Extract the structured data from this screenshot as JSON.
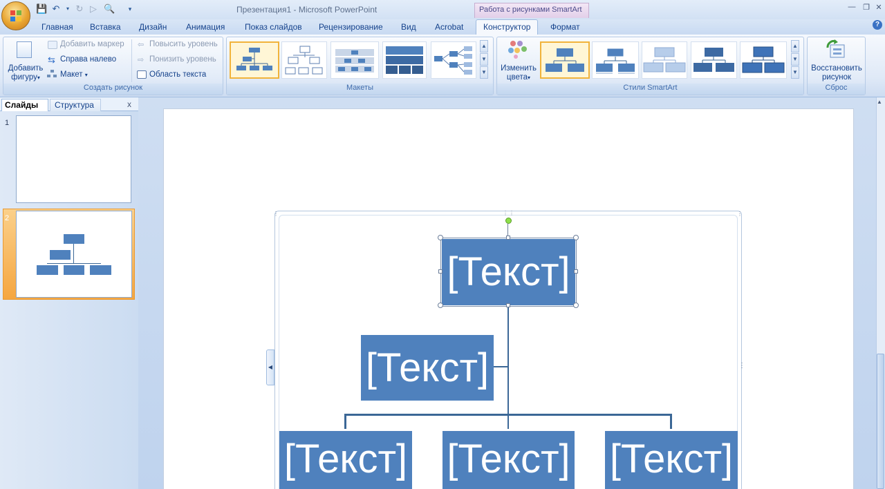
{
  "title_bar": {
    "document_title": "Презентация1 - Microsoft PowerPoint",
    "context_tab_header": "Работа с рисунками SmartArt"
  },
  "tabs": [
    "Главная",
    "Вставка",
    "Дизайн",
    "Анимация",
    "Показ слайдов",
    "Рецензирование",
    "Вид",
    "Acrobat",
    "Конструктор",
    "Формат"
  ],
  "active_tab": "Конструктор",
  "ribbon": {
    "create_graphic": {
      "label": "Создать рисунок",
      "add_shape": "Добавить фигуру",
      "add_shape_line1": "Добавить",
      "add_shape_line2": "фигуру",
      "add_bullet": "Добавить маркер",
      "right_to_left": "Справа налево",
      "layout": "Макет",
      "promote": "Повысить уровень",
      "demote": "Понизить уровень",
      "text_pane": "Область текста"
    },
    "layouts": {
      "label": "Макеты"
    },
    "styles": {
      "label": "Стили SmartArt",
      "change_colors_line1": "Изменить",
      "change_colors_line2": "цвета"
    },
    "reset": {
      "label": "Сброс",
      "reset_graphic_line1": "Восстановить",
      "reset_graphic_line2": "рисунок"
    }
  },
  "left_panel": {
    "tab_slides": "Слайды",
    "tab_outline": "Структура",
    "close": "x",
    "slides": [
      {
        "number": "1"
      },
      {
        "number": "2"
      }
    ]
  },
  "smartart": {
    "top": "[Текст]",
    "assistant": "[Текст]",
    "children": [
      "[Текст]",
      "[Текст]",
      "[Текст]"
    ]
  },
  "colors": {
    "box_fill": "#4F81BD",
    "connector": "#3B6796",
    "selected_gallery_border": "#F1B33A"
  }
}
